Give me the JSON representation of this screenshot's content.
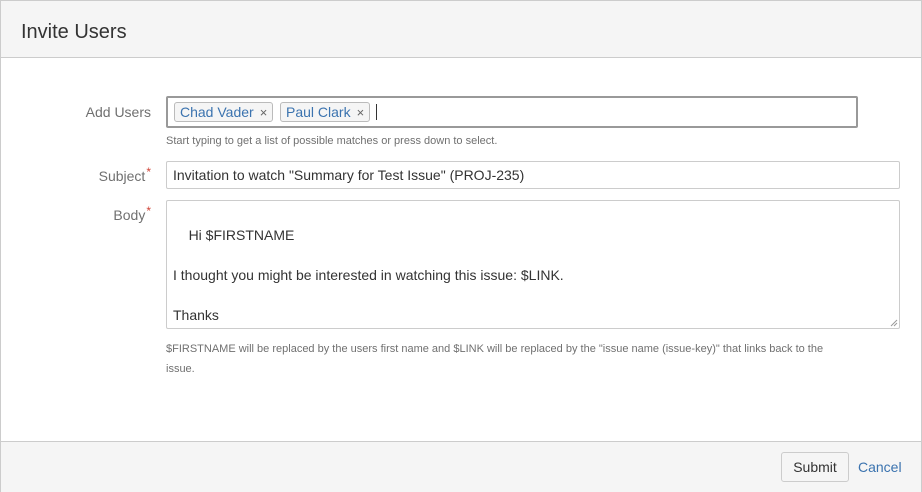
{
  "dialog": {
    "title": "Invite Users"
  },
  "form": {
    "add_users": {
      "label": "Add Users",
      "selected": [
        {
          "name": "Chad Vader",
          "remove": "×"
        },
        {
          "name": "Paul Clark",
          "remove": "×"
        }
      ],
      "hint": "Start typing to get a list of possible matches or press down to select."
    },
    "subject": {
      "label": "Subject",
      "required_mark": "*",
      "value": "Invitation to watch \"Summary for Test Issue\" (PROJ-235)"
    },
    "body": {
      "label": "Body",
      "required_mark": "*",
      "value": "Hi $FIRSTNAME\n\nI thought you might be interested in watching this issue: $LINK.\n\nThanks\nPaul Clark",
      "hint_line1": "$FIRSTNAME will be replaced by the users first name and $LINK will be replaced by the \"issue name (issue-key)\" that links back to the",
      "hint_line2": "issue."
    }
  },
  "footer": {
    "submit_label": "Submit",
    "cancel_label": "Cancel"
  },
  "colors": {
    "link": "#3b73af",
    "required": "#d04437"
  }
}
